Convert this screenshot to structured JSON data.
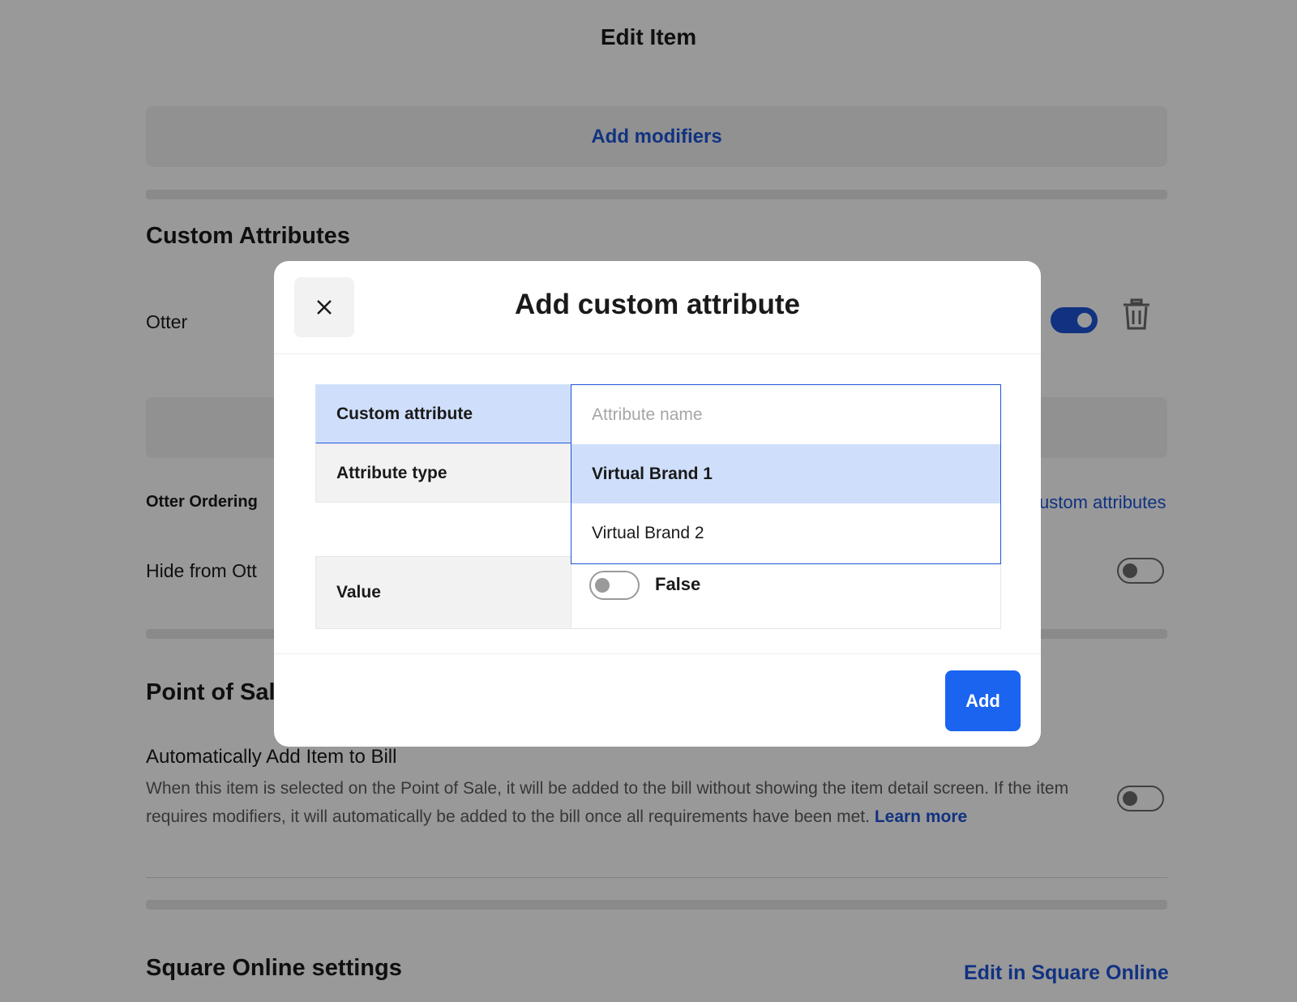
{
  "page": {
    "title": "Edit Item",
    "add_modifiers": "Add modifiers",
    "custom_attributes_title": "Custom Attributes",
    "otter_label": "Otter",
    "otter_ordering_label": "Otter Ordering",
    "custom_attributes_link": "ustom attributes",
    "hide_from_label": "Hide from Ott",
    "pos_title": "Point of Sale",
    "auto_add_title": "Automatically Add Item to Bill",
    "auto_add_desc": "When this item is selected on the Point of Sale, it will be added to the bill without showing the item detail screen. If the item requires modifiers, it will automatically be added to the bill once all requirements have been met.",
    "learn_more": "Learn more",
    "square_online_title": "Square Online settings",
    "edit_square_online": "Edit in Square Online"
  },
  "modal": {
    "title": "Add custom attribute",
    "rows": {
      "custom_attribute": "Custom attribute",
      "attribute_type": "Attribute type",
      "value": "Value"
    },
    "attribute_name_placeholder": "Attribute name",
    "options": [
      "Virtual Brand 1",
      "Virtual Brand 2"
    ],
    "value_text": "False",
    "add_button": "Add"
  },
  "colors": {
    "accent": "#1d54d7",
    "button": "#1a64f0",
    "highlight": "#cfdffb"
  }
}
